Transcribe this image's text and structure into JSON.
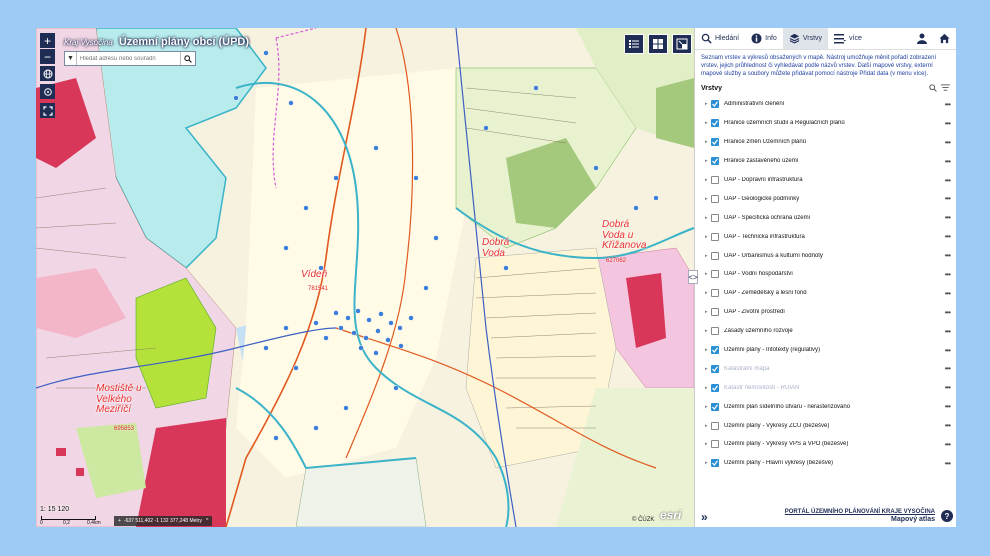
{
  "map": {
    "region": "Kraj Vysočina",
    "title": "Územní plány obcí (ÚPD)",
    "search_placeholder": "Hledat adresu nebo souřadn",
    "zoom_in": "+",
    "zoom_out": "−",
    "scale": "1: 15 120",
    "scale_ticks": [
      "0",
      "0,2",
      "0,4km"
    ],
    "coords": "-637 511,402 -1 132 377,248 Metry",
    "copyright": "© ČÚZK",
    "esri": "esri",
    "places": [
      {
        "name": "Vídeň",
        "code": "781541"
      },
      {
        "name": "Dobrá Voda",
        "code": ""
      },
      {
        "name": "Dobrá Voda u Křižanova",
        "code": "627062"
      },
      {
        "name": "Mostiště u Velkého Meziříčí",
        "code": "695853"
      }
    ]
  },
  "panel": {
    "tabs": [
      {
        "label": "Hledání",
        "icon": "search-icon"
      },
      {
        "label": "Info",
        "icon": "info-icon"
      },
      {
        "label": "Vrstvy",
        "icon": "layers-icon"
      },
      {
        "label": "více",
        "icon": "menu-icon"
      }
    ],
    "intro": "Seznam vrstev a výkresů obsažených v mapě. Nástroj umožňuje měnit pořadí zobrazení vrstev, jejich průhlednost či vyhledávat podle názvů vrstev. Další mapové vrstvy, externí mapové služby a soubory můžete přidávat pomocí nástroje Přidat data (v menu více).",
    "layers_title": "Vrstvy",
    "layers": [
      {
        "label": "Administrativní členění",
        "checked": true
      },
      {
        "label": "Hranice územních studií a Regulačních plánů",
        "checked": true
      },
      {
        "label": "Hranice změn Územních plánů",
        "checked": true
      },
      {
        "label": "Hranice zastavěného území",
        "checked": true
      },
      {
        "label": "ÚAP - Dopravní infrastruktura",
        "checked": false
      },
      {
        "label": "ÚAP - Geologické podmínky",
        "checked": false
      },
      {
        "label": "ÚAP - Specifická ochrana území",
        "checked": false
      },
      {
        "label": "ÚAP - Technická infrastruktura",
        "checked": false
      },
      {
        "label": "ÚAP - Urbanismus a kulturní hodnoty",
        "checked": false
      },
      {
        "label": "ÚAP - Vodní hospodářství",
        "checked": false
      },
      {
        "label": "ÚAP - Zemědělský a lesní fond",
        "checked": false
      },
      {
        "label": "ÚAP - Životní prostředí",
        "checked": false
      },
      {
        "label": "Zásady územního rozvoje",
        "checked": false
      },
      {
        "label": "Územní plány - Infotexty (regulativy)",
        "checked": true
      },
      {
        "label": "Katastrální mapa",
        "checked": true,
        "dim": true
      },
      {
        "label": "Katastr nemovitostí - RÚIAN",
        "checked": true,
        "dim": true
      },
      {
        "label": "Územní plán sídelního útvaru - nerasterizováno",
        "checked": true
      },
      {
        "label": "Územní plány - Výkresy ZČÚ (bezešvé)",
        "checked": false
      },
      {
        "label": "Územní plány - Výkresy VPS a VPO (bezešvé)",
        "checked": false
      },
      {
        "label": "Územní plány - Hlavní výkresy (bezešvé)",
        "checked": true
      }
    ],
    "footer_link": "PORTÁL ÚZEMNÍHO PLÁNOVÁNÍ KRAJE VYSOČINA",
    "footer_sub": "Mapový atlas",
    "help": "?",
    "expand": "»"
  },
  "colors": {
    "navy": "#1f2d54",
    "checkbox": "#2b8fd6",
    "intro_text": "#1f3fa0",
    "place_label": "#e83030",
    "background": "#9ecbf5"
  }
}
